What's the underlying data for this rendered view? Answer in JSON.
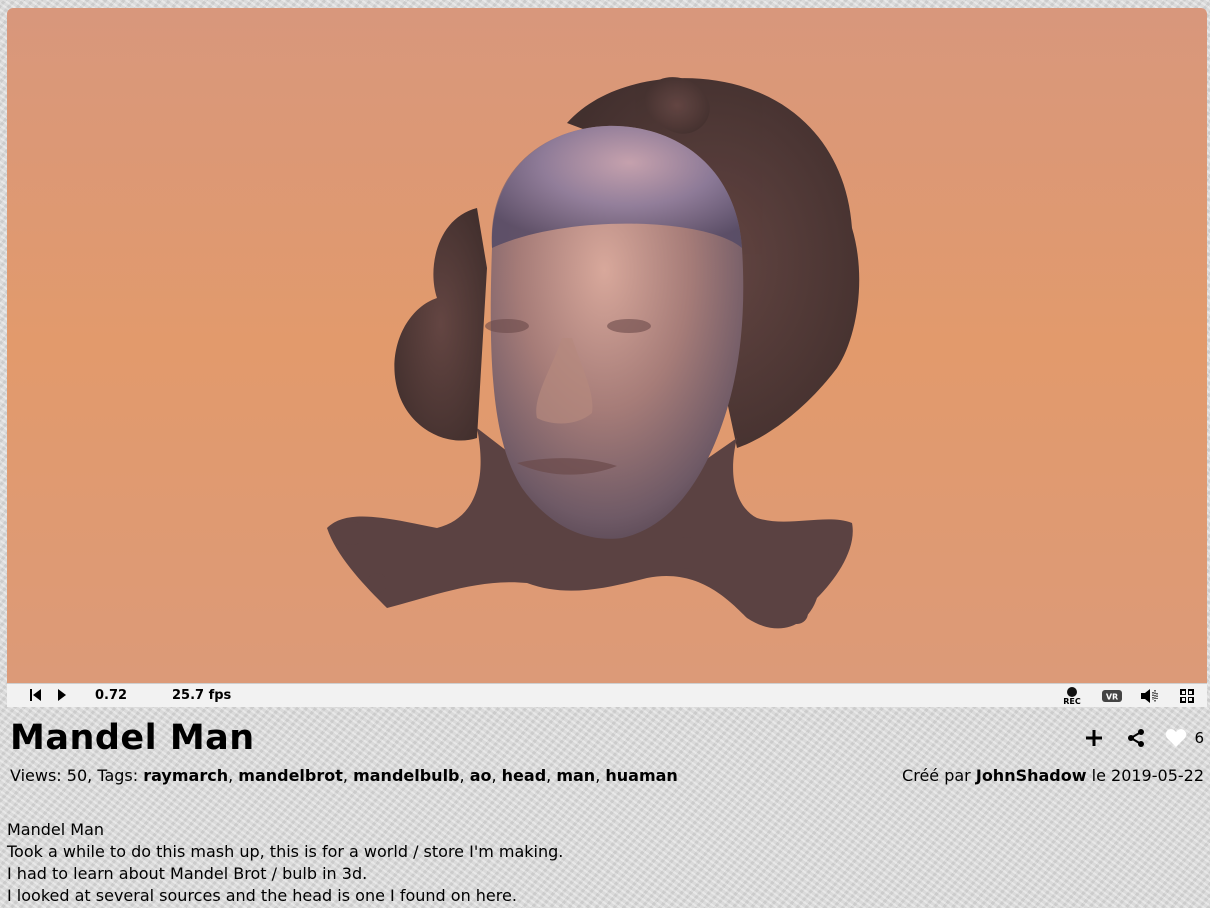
{
  "shader": {
    "title": "Mandel Man",
    "views_label": "Views:",
    "views_count": "50",
    "tags_label": "Tags:",
    "tags": [
      "raymarch",
      "mandelbrot",
      "mandelbulb",
      "ao",
      "head",
      "man",
      "huaman"
    ],
    "created_prefix": "Créé par",
    "author": "JohnShadow",
    "created_suffix": "le",
    "date": "2019-05-22",
    "likes": "6"
  },
  "player": {
    "time": "0.72",
    "fps": "25.7 fps",
    "rec_label": "REC",
    "vr_label": "VR"
  },
  "description": [
    "Mandel Man",
    "Took a while to do this mash up, this is for a world / store I'm making.",
    "I had to learn about Mandel Brot / bulb in 3d.",
    "I looked at several sources and the head is one I found on here."
  ],
  "icons": {
    "rewind": "skip-back-icon",
    "play": "play-icon",
    "rec": "record-icon",
    "vr": "vr-headset-icon",
    "volume": "volume-icon",
    "fullscreen": "fullscreen-icon",
    "add": "plus-icon",
    "share": "share-icon",
    "like": "heart-icon"
  },
  "colors": {
    "background_top": "#d8977c",
    "background_mid": "#e29a6c",
    "skin": "#b98a7e",
    "fractal": "#6e4f4c"
  }
}
